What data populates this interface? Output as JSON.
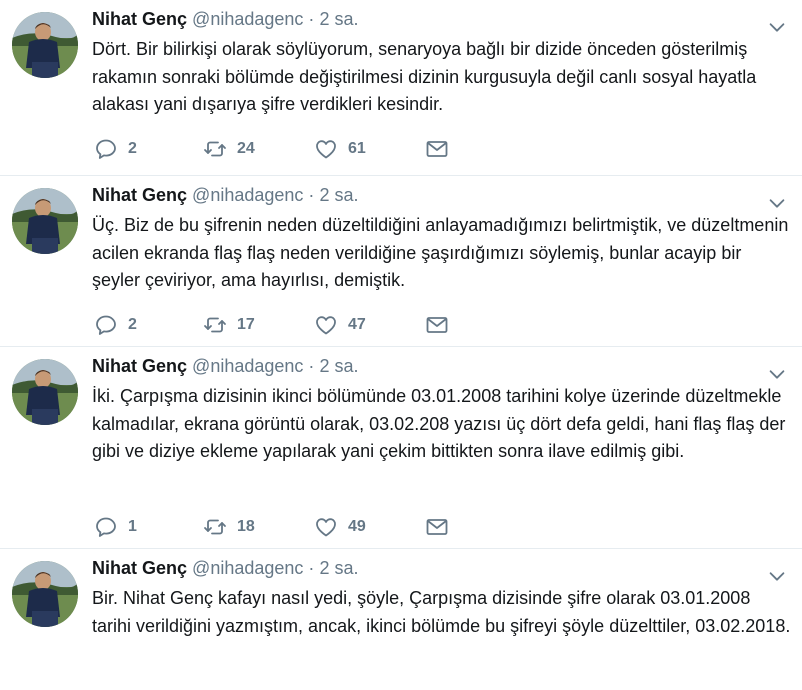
{
  "tweets": [
    {
      "name": "Nihat Genç",
      "handle": "@nihadagenc",
      "dot": "·",
      "time": "2 sa.",
      "text": "Dört. Bir bilirkişi olarak söylüyorum, senaryoya bağlı bir dizide önceden gösterilmiş rakamın sonraki bölümde değiştirilmesi dizinin kurgusuyla değil canlı sosyal hayatla alakası yani dışarıya şifre verdikleri kesindir.",
      "replies": "2",
      "retweets": "24",
      "likes": "61"
    },
    {
      "name": "Nihat Genç",
      "handle": "@nihadagenc",
      "dot": "·",
      "time": "2 sa.",
      "text": "Üç. Biz de bu şifrenin neden düzeltildiğini anlayamadığımızı belirtmiştik, ve düzeltmenin acilen ekranda flaş flaş neden verildiğine şaşırdığımızı söylemiş, bunlar acayip bir şeyler çeviriyor, ama hayırlısı, demiştik.",
      "replies": "2",
      "retweets": "17",
      "likes": "47"
    },
    {
      "name": "Nihat Genç",
      "handle": "@nihadagenc",
      "dot": "·",
      "time": "2 sa.",
      "text": "İki. Çarpışma dizisinin ikinci bölümünde 03.01.2008 tarihini kolye üzerinde düzeltmekle kalmadılar, ekrana görüntü olarak, 03.02.208 yazısı üç dört defa geldi, hani flaş flaş der gibi ve diziye ekleme yapılarak yani çekim bittikten sonra ilave edilmiş gibi.",
      "replies": "1",
      "retweets": "18",
      "likes": "49"
    },
    {
      "name": "Nihat Genç",
      "handle": "@nihadagenc",
      "dot": "·",
      "time": "2 sa.",
      "text": "Bir. Nihat Genç kafayı nasıl yedi, şöyle, Çarpışma dizisinde şifre olarak 03.01.2008 tarihi verildiğini yazmıştım, ancak, ikinci bölümde bu şifreyi şöyle düzelttiler, 03.02.2018."
    }
  ],
  "icons": {
    "reply": "reply-icon",
    "retweet": "retweet-icon",
    "like": "heart-icon",
    "dm": "envelope-icon",
    "more": "chevron-down-icon"
  },
  "colors": {
    "text": "#14171a",
    "muted": "#657786",
    "divider": "#e6ecf0"
  }
}
